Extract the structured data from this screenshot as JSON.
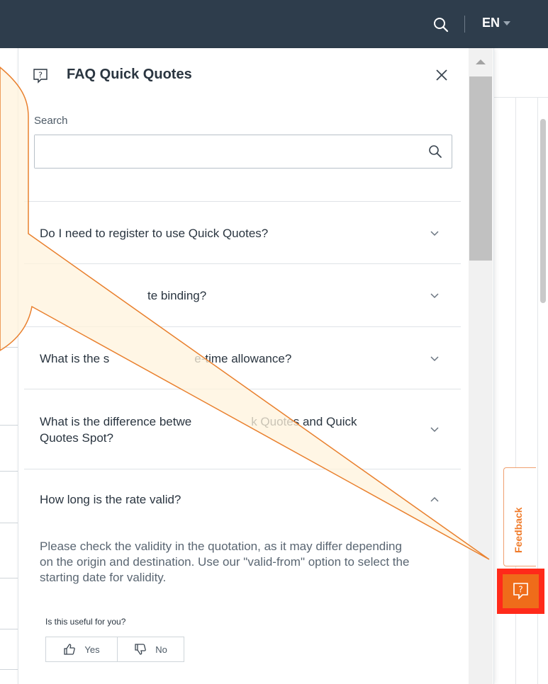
{
  "topbar": {
    "language": "EN",
    "colors": {
      "background": "#2e3d4c"
    }
  },
  "panel": {
    "title": "FAQ Quick Quotes",
    "search": {
      "label": "Search",
      "value": "",
      "placeholder": ""
    }
  },
  "faq": {
    "items": [
      {
        "question": "Do I need to register to use Quick Quotes?",
        "expanded": false
      },
      {
        "question": "Is the rate binding?",
        "visible_text": "te binding?",
        "expanded": false
      },
      {
        "question": "What is the standard free-time allowance?",
        "visible_prefix": "What is the s",
        "visible_suffix": "e-time allowance?",
        "expanded": false
      },
      {
        "question_line1": "What is the difference betwe",
        "question_line1_tail": "k Quotes and Quick",
        "question_line2": "Quotes Spot?",
        "expanded": false
      },
      {
        "question": "How long is the rate valid?",
        "expanded": true,
        "answer": "Please check the validity in the quotation, as it may differ depending on the origin and destination. Use our \"valid-from\" option to select the starting date for validity."
      }
    ],
    "useful_prompt": "Is this useful for you?",
    "yes_label": "Yes",
    "no_label": "No"
  },
  "feedback": {
    "label": "Feedback",
    "accent": "#ef6c1a",
    "highlight": "#ff2a1a"
  },
  "icons": [
    "search-icon",
    "chevron-down-icon",
    "chevron-up-icon",
    "close-icon",
    "help-question-icon",
    "thumbs-up-icon",
    "thumbs-down-icon"
  ]
}
